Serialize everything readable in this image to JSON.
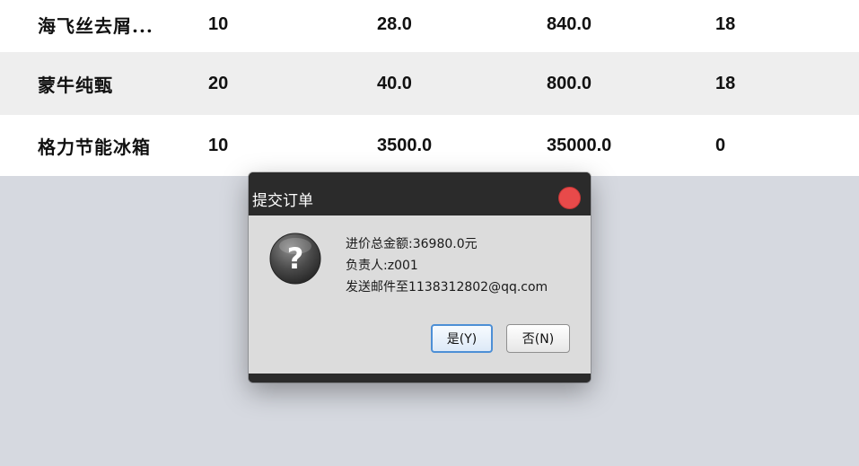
{
  "table": {
    "rows": [
      [
        "海飞丝去屑...",
        "10",
        "28.0",
        "840.0",
        "18"
      ],
      [
        "蒙牛纯甄",
        "20",
        "40.0",
        "800.0",
        "18"
      ],
      [
        "格力节能冰箱",
        "10",
        "3500.0",
        "35000.0",
        "0"
      ]
    ]
  },
  "dialog": {
    "title": "提交订单",
    "icon": "question-icon",
    "lines": [
      "进价总金额:36980.0元",
      "负责人:z001",
      "发送邮件至1138312802@qq.com"
    ],
    "yes_label": "是(Y)",
    "no_label": "否(N)"
  },
  "colors": {
    "background": "#d6d9e0",
    "dialog_frame": "#2b2b2b",
    "close_button": "#e84a4a",
    "default_button_border": "#4d8fd6"
  }
}
